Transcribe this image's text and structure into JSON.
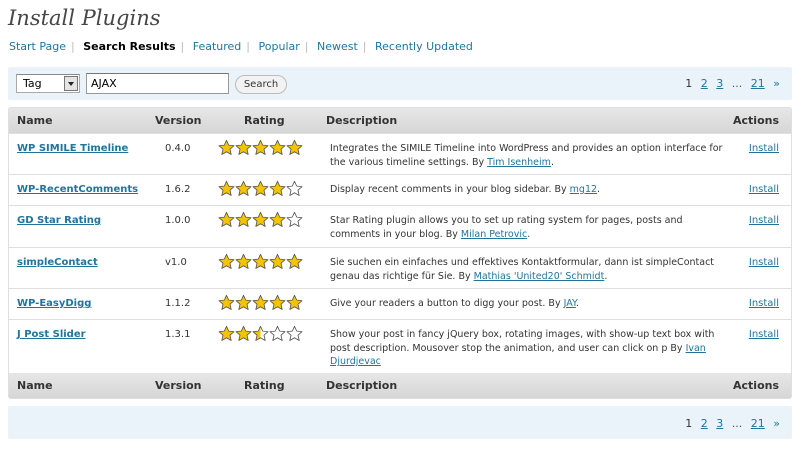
{
  "page_title": "Install Plugins",
  "subnav": [
    {
      "label": "Start Page",
      "current": false
    },
    {
      "label": "Search Results",
      "current": true
    },
    {
      "label": "Featured",
      "current": false
    },
    {
      "label": "Popular",
      "current": false
    },
    {
      "label": "Newest",
      "current": false
    },
    {
      "label": "Recently Updated",
      "current": false
    }
  ],
  "search": {
    "type_selected": "Tag",
    "value": "AJAX",
    "button_label": "Search"
  },
  "pagination": {
    "current": "1",
    "pages": [
      "2",
      "3"
    ],
    "dots": "...",
    "last": "21",
    "next": "»"
  },
  "columns": {
    "name": "Name",
    "version": "Version",
    "rating": "Rating",
    "description": "Description",
    "actions": "Actions"
  },
  "plugins": [
    {
      "name": "WP SIMILE Timeline",
      "version": "0.4.0",
      "rating": 5,
      "description": "Integrates the SIMILE Timeline into WordPress and provides an option interface for the various timeline settings. By ",
      "author": "Tim Isenheim",
      "author_suffix": ".",
      "action": "Install"
    },
    {
      "name": "WP-RecentComments",
      "version": "1.6.2",
      "rating": 4,
      "description": "Display recent comments in your blog sidebar. By ",
      "author": "mg12",
      "author_suffix": ".",
      "action": "Install"
    },
    {
      "name": "GD Star Rating",
      "version": "1.0.0",
      "rating": 4,
      "description": "Star Rating plugin allows you to set up rating system for pages, posts and comments in your blog. By ",
      "author": "Milan Petrovic",
      "author_suffix": ".",
      "action": "Install"
    },
    {
      "name": "simpleContact",
      "version": "v1.0",
      "rating": 5,
      "description": "Sie suchen ein einfaches und effektives Kontaktformular, dann ist simpleContact genau das richtige für Sie. By ",
      "author": "Mathias 'United20' Schmidt",
      "author_suffix": ".",
      "action": "Install"
    },
    {
      "name": "WP-EasyDigg",
      "version": "1.1.2",
      "rating": 5,
      "description": "Give your readers a button to digg your post. By ",
      "author": "JAY",
      "author_suffix": ".",
      "action": "Install"
    },
    {
      "name": "J Post Slider",
      "version": "1.3.1",
      "rating": 2.5,
      "description": "Show your post in fancy jQuery box, rotating images, with show-up text box with post description. Mousover stop the animation, and user can click on p By ",
      "author": "Ivan Djurdjevac",
      "author_suffix": "",
      "action": "Install"
    }
  ],
  "colors": {
    "link": "#21759b",
    "star_fill": "#f5c400",
    "star_stroke": "#555555",
    "nav_bg": "#eaf3fa"
  }
}
